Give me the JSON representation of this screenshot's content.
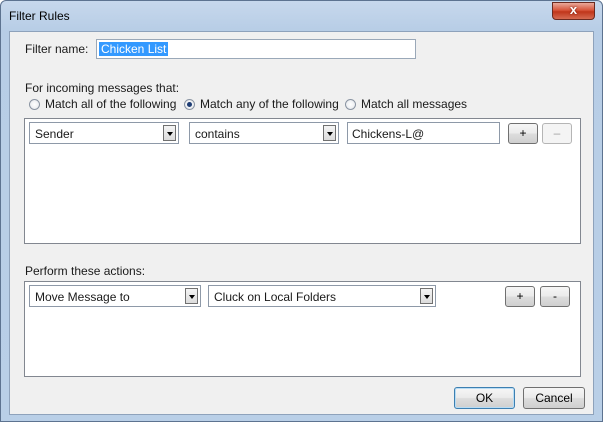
{
  "window": {
    "title": "Filter Rules",
    "close_glyph": "x"
  },
  "filter_name": {
    "label": "Filter name:",
    "value": "Chicken List"
  },
  "incoming": {
    "label": "For incoming messages that:",
    "options": [
      {
        "label": "Match all of the following",
        "checked": false
      },
      {
        "label": "Match any of the following",
        "checked": true
      },
      {
        "label": "Match all messages",
        "checked": false
      }
    ]
  },
  "rules": [
    {
      "field": "Sender",
      "operator": "contains",
      "value": "Chickens-L@",
      "add_label": "+",
      "remove_label": "–",
      "remove_enabled": false
    }
  ],
  "actions": {
    "label": "Perform these actions:",
    "items": [
      {
        "action": "Move Message to",
        "target": "Cluck on Local Folders",
        "add_label": "+",
        "remove_label": "-"
      }
    ]
  },
  "buttons": {
    "ok": "OK",
    "cancel": "Cancel"
  },
  "colors": {
    "selection": "#3399ff",
    "dialog_bg": "#f0f0f0",
    "frame": "#b9cfe7"
  },
  "icons": {
    "close": "close-icon",
    "dropdown": "chevron-down-icon"
  }
}
